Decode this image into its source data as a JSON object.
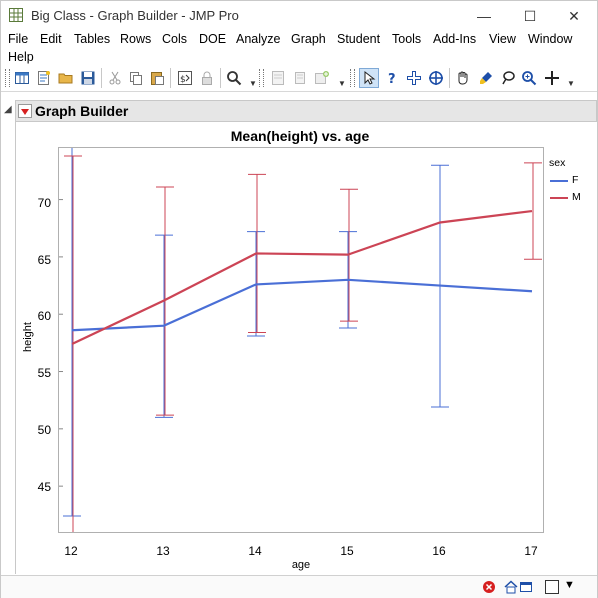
{
  "window": {
    "title": "Big Class - Graph Builder - JMP Pro",
    "controls": {
      "minimize": "—",
      "maximize": "☐",
      "close": "✕"
    }
  },
  "menu": [
    "File",
    "Edit",
    "Tables",
    "Rows",
    "Cols",
    "DOE",
    "Analyze",
    "Graph",
    "Student",
    "Tools",
    "Add-Ins",
    "View",
    "Window",
    "Help"
  ],
  "toolbar": {
    "icons": [
      "new-data-table-icon",
      "new-script-icon",
      "open-icon",
      "save-icon",
      "cut-icon",
      "copy-icon",
      "paste-icon",
      "script-window-icon",
      "lock-icon",
      "search-icon",
      "report-icon",
      "copy-report-icon",
      "add-graph-icon",
      "arrow-tool-icon",
      "help-tool-icon",
      "selection-tool-icon",
      "crosshair-tool-icon",
      "hand-tool-icon",
      "brush-tool-icon",
      "lasso-tool-icon",
      "magnifier-tool-icon",
      "annotate-tool-icon"
    ]
  },
  "outline": {
    "title": "Graph Builder"
  },
  "chart_data": {
    "type": "line",
    "title": "Mean(height) vs. age",
    "xlabel": "age",
    "ylabel": "height",
    "categories": [
      12,
      13,
      14,
      15,
      16,
      17
    ],
    "yticks": [
      45,
      50,
      55,
      60,
      65,
      70
    ],
    "ylim": [
      41,
      74.5
    ],
    "legend": {
      "title": "sex",
      "position": "right"
    },
    "series": [
      {
        "name": "F",
        "color": "#4a6fd6",
        "values": [
          58.6,
          59.0,
          62.6,
          63.0,
          62.5,
          62.0
        ],
        "error_low": [
          42.4,
          51.0,
          58.1,
          58.8,
          51.9,
          null
        ],
        "error_high": [
          74.8,
          66.9,
          67.2,
          67.2,
          73.0,
          null
        ]
      },
      {
        "name": "M",
        "color": "#cc4455",
        "values": [
          57.4,
          61.2,
          65.3,
          65.2,
          68.0,
          69.0
        ],
        "error_low": [
          null,
          51.2,
          58.4,
          59.4,
          null,
          64.8
        ],
        "error_high": [
          73.8,
          71.1,
          72.2,
          70.9,
          null,
          73.2
        ]
      }
    ]
  }
}
